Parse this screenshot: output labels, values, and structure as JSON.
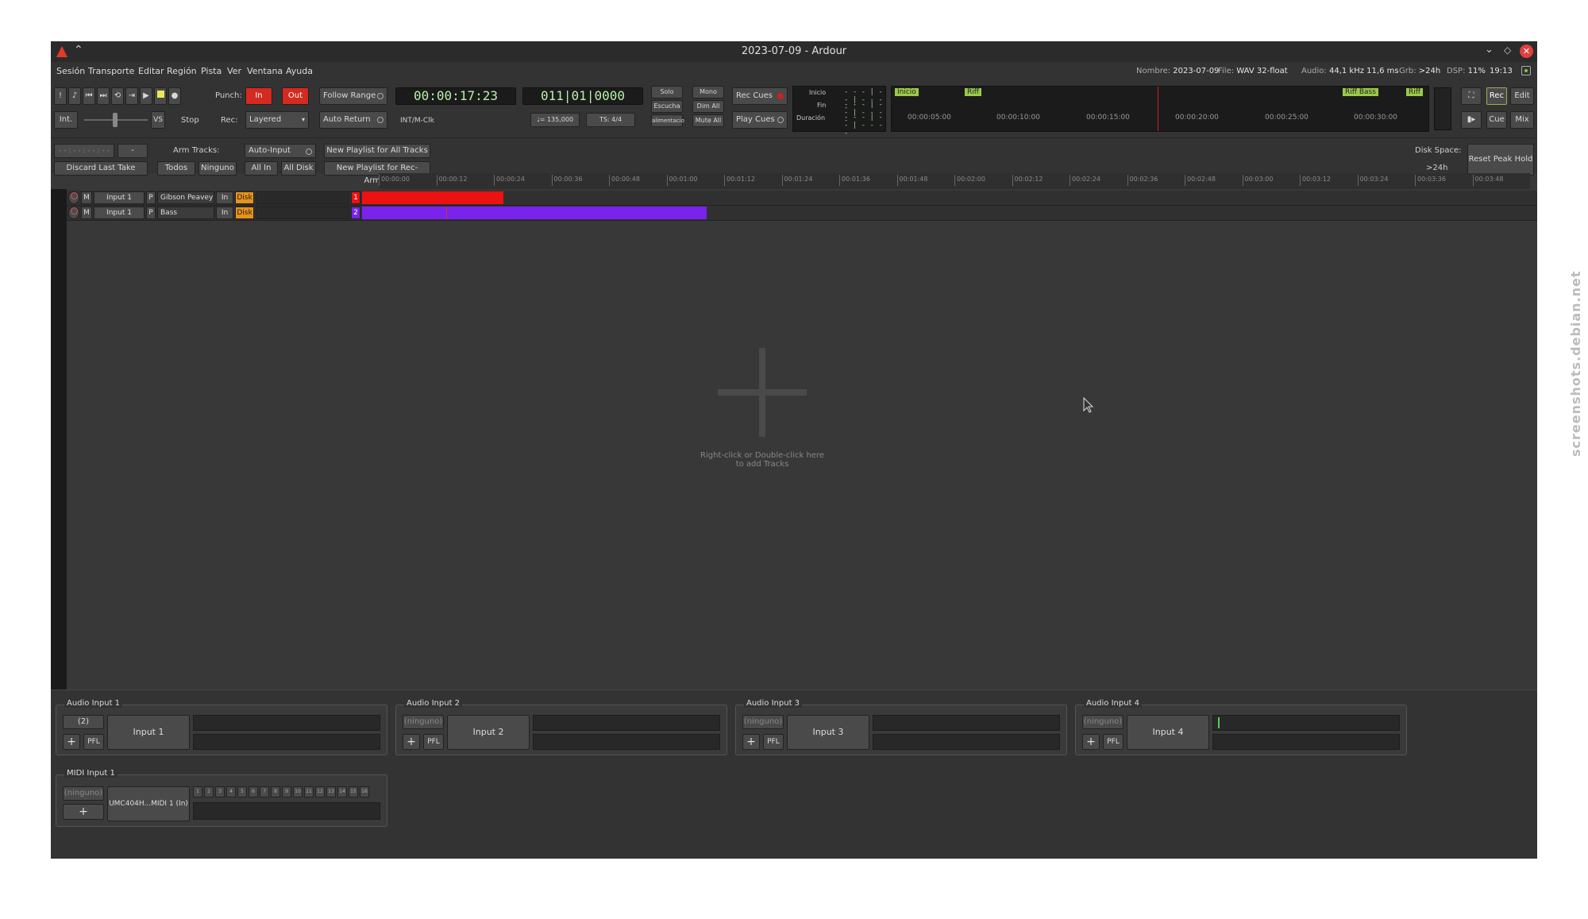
{
  "window": {
    "title": "2023-07-09 - Ardour"
  },
  "menu": [
    "Sesión",
    "Transporte",
    "Editar",
    "Región",
    "Pista",
    "Ver",
    "Ventana",
    "Ayuda"
  ],
  "status": {
    "name_label": "Nombre:",
    "name_value": "2023-07-09",
    "file_label": "File:",
    "file_value": "WAV 32-float",
    "audio_label": "Audio:",
    "audio_value": "44,1 kHz 11,6 ms",
    "grb_label": "Grb:",
    "grb_value": ">24h",
    "dsp_label": "DSP:",
    "dsp_value": "11%",
    "time": "19:13"
  },
  "transport": {
    "punch_label": "Punch:",
    "in": "In",
    "out": "Out",
    "int": "Int.",
    "vs": "VS",
    "stop": "Stop",
    "rec_label": "Rec:",
    "rec_mode": "Layered",
    "follow_range": "Follow Range",
    "auto_return": "Auto Return",
    "int_mclk": "INT/M-Clk",
    "primary_clock": "00:00:17:23",
    "secondary_clock": "011|01|0000",
    "tempo": "♩= 135,000",
    "ts": "TS: 4/4",
    "solo": "Solo",
    "escucha": "Escucha",
    "alimentacion": "alimentacio",
    "mono": "Mono",
    "dim_all": "Dim All",
    "mute_all": "Mute All",
    "rec_cues": "Rec Cues",
    "play_cues": "Play Cues",
    "inicio": "Inicio",
    "fin": "Fin",
    "duracion": "Duración",
    "range_value": "- - - | - - | - - - -"
  },
  "mini_timeline": {
    "markers": [
      "Inicio",
      "Riff",
      "Riff Bass",
      "Riff"
    ],
    "times": [
      "00:00:05:00",
      "00:00:10:00",
      "00:00:15:00",
      "00:00:20:00",
      "00:00:25:00",
      "00:00:30:00"
    ]
  },
  "right_buttons": {
    "rec": "Rec",
    "edit": "Edit",
    "cue": "Cue",
    "mix": "Mix"
  },
  "rec_toolbar": {
    "nudge_clock": "- - : - - : - - : - -",
    "nudge_minus": "-",
    "discard_last_take": "Discard Last Take",
    "arm_tracks": "Arm Tracks:",
    "todos": "Todos",
    "ninguno": "Ninguno",
    "auto_input": "Auto-Input",
    "all_in": "All In",
    "all_disk": "All Disk",
    "new_playlist_all": "New Playlist for All Tracks",
    "new_playlist_armed": "New Playlist for Rec-Armed",
    "disk_space_label": "Disk Space:",
    "disk_space_value": ">24h",
    "reset_peak_hold": "Reset Peak Hold"
  },
  "ruler": [
    "00:00:00",
    "00:00:12",
    "00:00:24",
    "00:00:36",
    "00:00:48",
    "00:01:00",
    "00:01:12",
    "00:01:24",
    "00:01:36",
    "00:01:48",
    "00:02:00",
    "00:02:12",
    "00:02:24",
    "00:02:36",
    "00:02:48",
    "00:03:00",
    "00:03:12",
    "00:03:24",
    "00:03:36",
    "00:03:48"
  ],
  "tracks": [
    {
      "m": "M",
      "input": "Input 1",
      "p": "P",
      "name": "Gibson Peavey",
      "in": "In",
      "disk": "Disk",
      "num": "1",
      "color": "#ee1111"
    },
    {
      "m": "M",
      "input": "Input 1",
      "p": "P",
      "name": "Bass",
      "in": "In",
      "disk": "Disk",
      "num": "2",
      "color": "#7a22ee"
    }
  ],
  "empty_hint": {
    "line1": "Right-click or Double-click here",
    "line2": "to add Tracks"
  },
  "inputs": [
    {
      "title": "Audio Input 1",
      "count": "(2)",
      "input": "Input 1",
      "pfl": "PFL",
      "add": "+"
    },
    {
      "title": "Audio Input 2",
      "count": "(ninguno)",
      "input": "Input 2",
      "pfl": "PFL",
      "add": "+"
    },
    {
      "title": "Audio Input 3",
      "count": "(ninguno)",
      "input": "Input 3",
      "pfl": "PFL",
      "add": "+"
    },
    {
      "title": "Audio Input 4",
      "count": "(ninguno)",
      "input": "Input 4",
      "pfl": "PFL",
      "add": "+"
    }
  ],
  "midi_input": {
    "title": "MIDI Input 1",
    "count": "(ninguno)",
    "input": "UMC404H...MIDI 1 (In)",
    "add": "+"
  },
  "midi_channels": [
    "1",
    "2",
    "3",
    "4",
    "5",
    "6",
    "7",
    "8",
    "9",
    "10",
    "11",
    "12",
    "13",
    "14",
    "15",
    "16"
  ],
  "watermark": "screenshots.debian.net"
}
